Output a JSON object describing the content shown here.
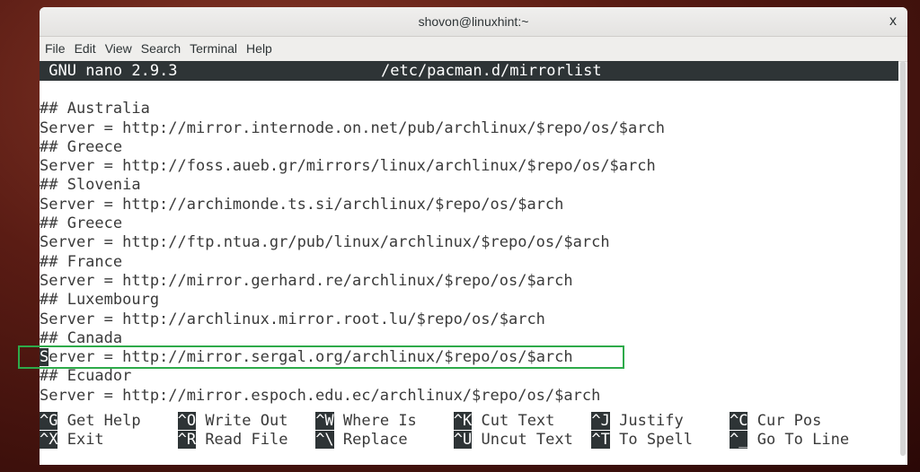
{
  "window": {
    "title": "shovon@linuxhint:~",
    "close_label": "x"
  },
  "menu": [
    "File",
    "Edit",
    "View",
    "Search",
    "Terminal",
    "Help"
  ],
  "nano": {
    "version": "GNU nano 2.9.3",
    "filename": "/etc/pacman.d/mirrorlist"
  },
  "lines": [
    "",
    "## Australia",
    "Server = http://mirror.internode.on.net/pub/archlinux/$repo/os/$arch",
    "## Greece",
    "Server = http://foss.aueb.gr/mirrors/linux/archlinux/$repo/os/$arch",
    "## Slovenia",
    "Server = http://archimonde.ts.si/archlinux/$repo/os/$arch",
    "## Greece",
    "Server = http://ftp.ntua.gr/pub/linux/archlinux/$repo/os/$arch",
    "## France",
    "Server = http://mirror.gerhard.re/archlinux/$repo/os/$arch",
    "## Luxembourg",
    "Server = http://archlinux.mirror.root.lu/$repo/os/$arch",
    "## Canada",
    "Server = http://mirror.sergal.org/archlinux/$repo/os/$arch",
    "## Ecuador",
    "Server = http://mirror.espoch.edu.ec/archlinux/$repo/os/$arch"
  ],
  "cursor": {
    "line": 14,
    "char": "S",
    "rest": "erver = http://mirror.sergal.org/archlinux/$repo/os/$arch"
  },
  "highlight_color": "#2eaa4a",
  "shortcuts": [
    [
      {
        "key": "^G",
        "label": "Get Help"
      },
      {
        "key": "^O",
        "label": "Write Out"
      },
      {
        "key": "^W",
        "label": "Where Is"
      },
      {
        "key": "^K",
        "label": "Cut Text"
      },
      {
        "key": "^J",
        "label": "Justify"
      },
      {
        "key": "^C",
        "label": "Cur Pos"
      }
    ],
    [
      {
        "key": "^X",
        "label": "Exit"
      },
      {
        "key": "^R",
        "label": "Read File"
      },
      {
        "key": "^\\",
        "label": "Replace"
      },
      {
        "key": "^U",
        "label": "Uncut Text"
      },
      {
        "key": "^T",
        "label": "To Spell"
      },
      {
        "key": "^_",
        "label": "Go To Line"
      }
    ]
  ]
}
